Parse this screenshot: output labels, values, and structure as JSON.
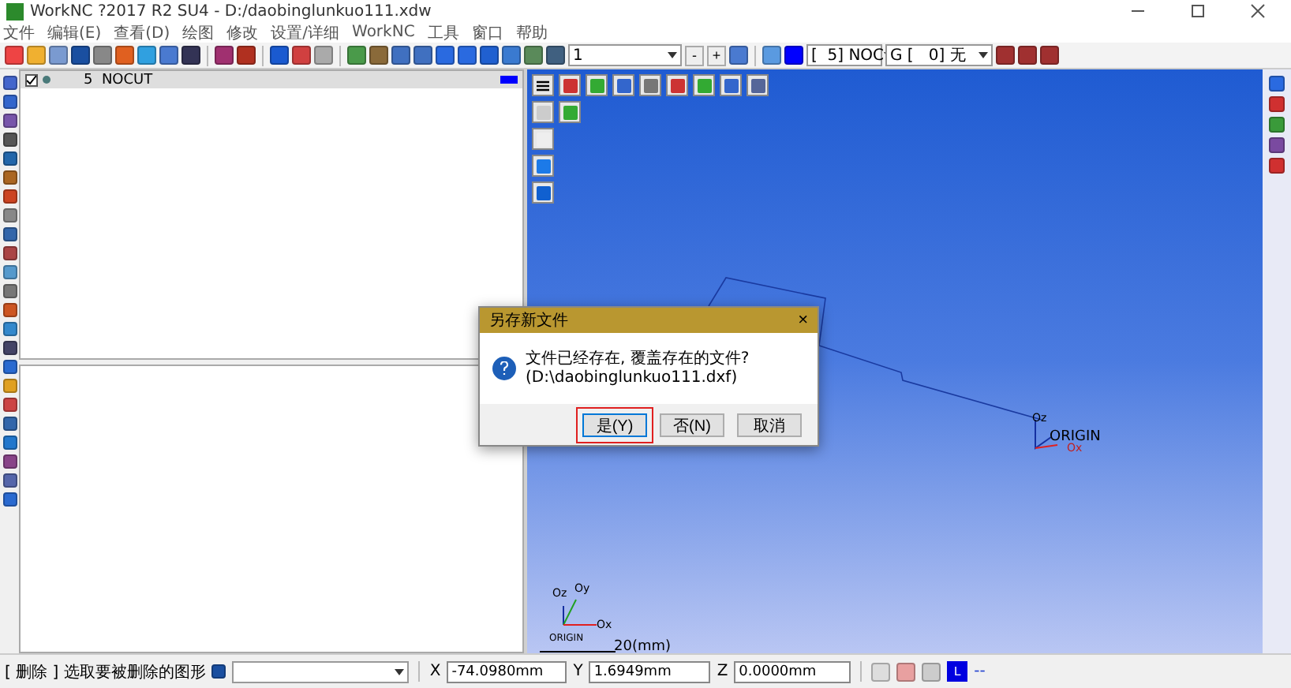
{
  "window": {
    "title": "WorkNC ?2017 R2 SU4 - D:/daobinglunkuo111.xdw"
  },
  "menu": [
    "文件",
    "编辑(E)",
    "查看(D)",
    "绘图",
    "修改",
    "设置/详细",
    "WorkNC",
    "工具",
    "窗口",
    "帮助"
  ],
  "toolbar": {
    "level": "1",
    "minus": "-",
    "plus": "+",
    "layer_combo": "[  5] NOC",
    "group_combo": "G [   0] 无"
  },
  "layers": [
    {
      "checked": true,
      "name": "5  NOCUT",
      "color": "#0000ff"
    }
  ],
  "viewport": {
    "right_origin": {
      "z": "Oz",
      "x": "Ox",
      "label": "ORIGIN"
    },
    "corner_origin": {
      "z": "Oz",
      "y": "Oy",
      "x": "Ox",
      "label": "ORIGIN"
    },
    "scale": "20(mm)"
  },
  "dialog": {
    "title": "另存新文件",
    "close": "×",
    "message": "文件已经存在, 覆盖存在的文件? (D:\\daobinglunkuo111.dxf)",
    "buttons": [
      {
        "label": "是(Y)",
        "selected": true
      },
      {
        "label": "否(N)",
        "selected": false
      },
      {
        "label": "取消",
        "selected": false
      }
    ]
  },
  "status_bar": {
    "prompt": "[ 删除 ] 选取要被删除的图形",
    "x_label": "X",
    "x": "-74.0980mm",
    "y_label": "Y",
    "y": "1.6949mm",
    "z_label": "Z",
    "z": "0.0000mm",
    "mode": "L",
    "extra": "--"
  }
}
